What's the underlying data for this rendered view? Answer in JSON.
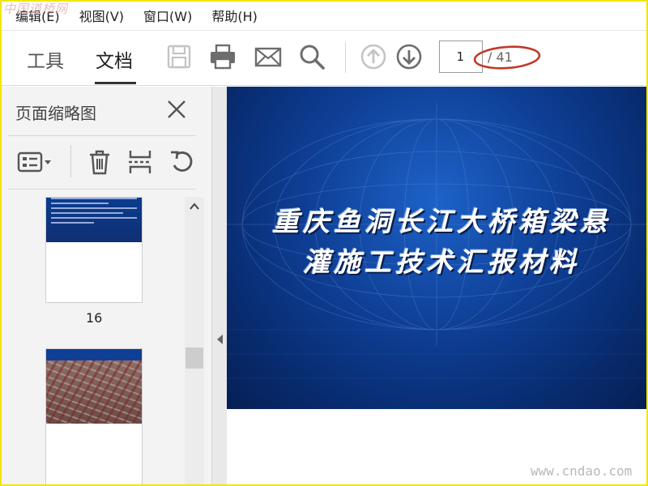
{
  "watermark_top_left": "中国道桥网",
  "watermark_bottom_right": "www.cndao.com",
  "menu": {
    "items": [
      "编辑(E)",
      "视图(V)",
      "窗口(W)",
      "帮助(H)"
    ]
  },
  "toolbar": {
    "tab_tools": "工具",
    "tab_document": "文档",
    "icons": [
      "save-icon",
      "print-icon",
      "email-icon",
      "search-icon",
      "arrow-up-circle-icon",
      "arrow-down-circle-icon"
    ],
    "page_current": "1",
    "page_total": "/ 41",
    "highlight_color": "#c0392b"
  },
  "panel": {
    "title": "页面缩略图",
    "tools": [
      "thumbnail-options-icon",
      "trash-icon",
      "extract-icon",
      "rotate-icon"
    ],
    "thumbnails": [
      {
        "label": "16"
      }
    ]
  },
  "slide": {
    "title_line1": "重庆鱼洞长江大桥箱梁悬",
    "title_line2": "灌施工技术汇报材料",
    "colors": {
      "background": "#0e3e94",
      "text": "#ffffff"
    }
  }
}
